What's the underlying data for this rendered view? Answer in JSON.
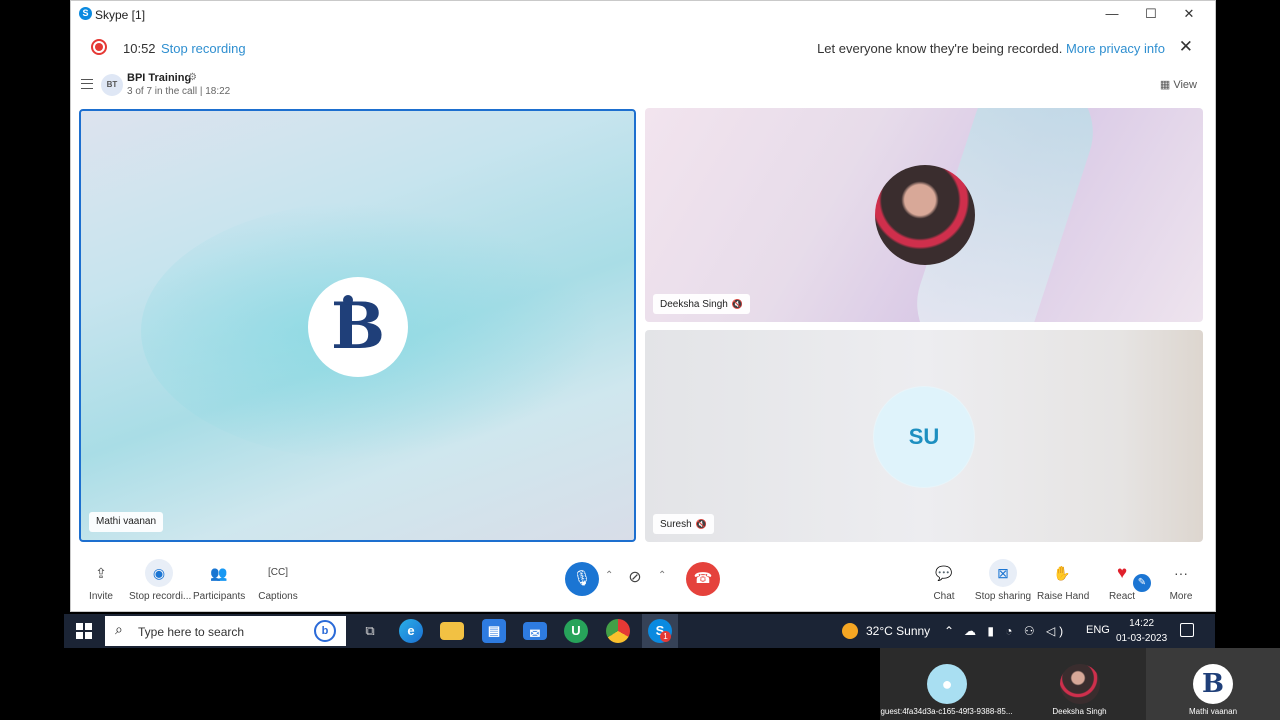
{
  "window": {
    "title": "Skype [1]",
    "controls": {
      "minimize": "—",
      "maximize": "☐",
      "close": "✕"
    }
  },
  "recording": {
    "time": "10:52",
    "stop_label": "Stop recording",
    "message": "Let everyone know they're being recorded.",
    "privacy_link": "More privacy info"
  },
  "call": {
    "avatar_initials": "BT",
    "title": "BPI Training",
    "subtitle": "3 of 7 in the call | 18:22",
    "view_label": "View"
  },
  "tiles": [
    {
      "name": "Mathi vaanan",
      "muted": false
    },
    {
      "name": "Deeksha Singh",
      "muted": true
    },
    {
      "name": "Suresh",
      "initials": "SU",
      "muted": true
    }
  ],
  "toolbar": {
    "left": [
      {
        "label": "Invite",
        "icon": "share-icon"
      },
      {
        "label": "Stop recordi...",
        "icon": "record-icon"
      },
      {
        "label": "Participants",
        "icon": "participants-icon"
      },
      {
        "label": "Captions",
        "icon": "captions-icon"
      }
    ],
    "right": [
      {
        "label": "Chat",
        "icon": "chat-icon"
      },
      {
        "label": "Stop sharing",
        "icon": "screen-share-icon"
      },
      {
        "label": "Raise Hand",
        "icon": "hand-icon"
      },
      {
        "label": "React",
        "icon": "heart-icon"
      },
      {
        "label": "More",
        "icon": "more-icon"
      }
    ]
  },
  "taskbar": {
    "search_placeholder": "Type here to search",
    "weather": "32°C  Sunny",
    "language": "ENG",
    "time": "14:22",
    "date": "01-03-2023",
    "skype_badge": "1"
  },
  "meeting_strip": [
    {
      "label": "guest:4fa34d3a-c165-49f3-9388-85..."
    },
    {
      "label": "Deeksha Singh"
    },
    {
      "label": "Mathi vaanan"
    }
  ],
  "colors": {
    "accent": "#1b75d3",
    "hangup": "#e5423c",
    "record": "#e53935",
    "link": "#2f8fd0",
    "taskbar": "#1b2435"
  }
}
